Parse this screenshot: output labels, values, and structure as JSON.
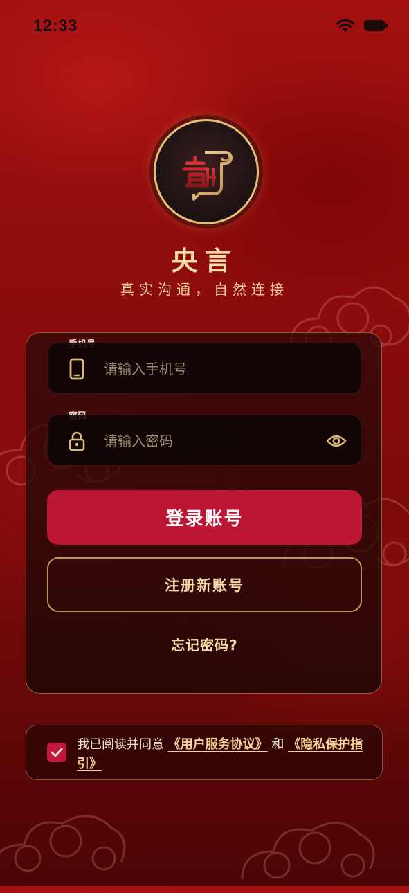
{
  "status_bar": {
    "time": "12:33"
  },
  "app": {
    "name": "央言",
    "slogan": "真实沟通，自然连接"
  },
  "login_form": {
    "phone_label": "手机号",
    "phone_placeholder": "请输入手机号",
    "password_label": "密码",
    "password_placeholder": "请输入密码",
    "login_button": "登录账号",
    "register_button": "注册新账号",
    "forgot_password": "忘记密码?"
  },
  "agreement": {
    "checked": true,
    "prefix": "我已阅读并同意",
    "user_agreement": "《用户服务协议》",
    "conjunction": "和",
    "privacy_policy": "《隐私保护指引》"
  },
  "icons": {
    "phone": "smartphone-icon",
    "lock": "lock-icon",
    "eye": "eye-icon",
    "check": "check-icon",
    "wifi": "wifi-icon",
    "battery": "battery-icon"
  },
  "colors": {
    "background": "#8e0c0c",
    "gold": "#e3c07a",
    "primary_button": "#bb1634",
    "checkbox": "#c2163a"
  }
}
